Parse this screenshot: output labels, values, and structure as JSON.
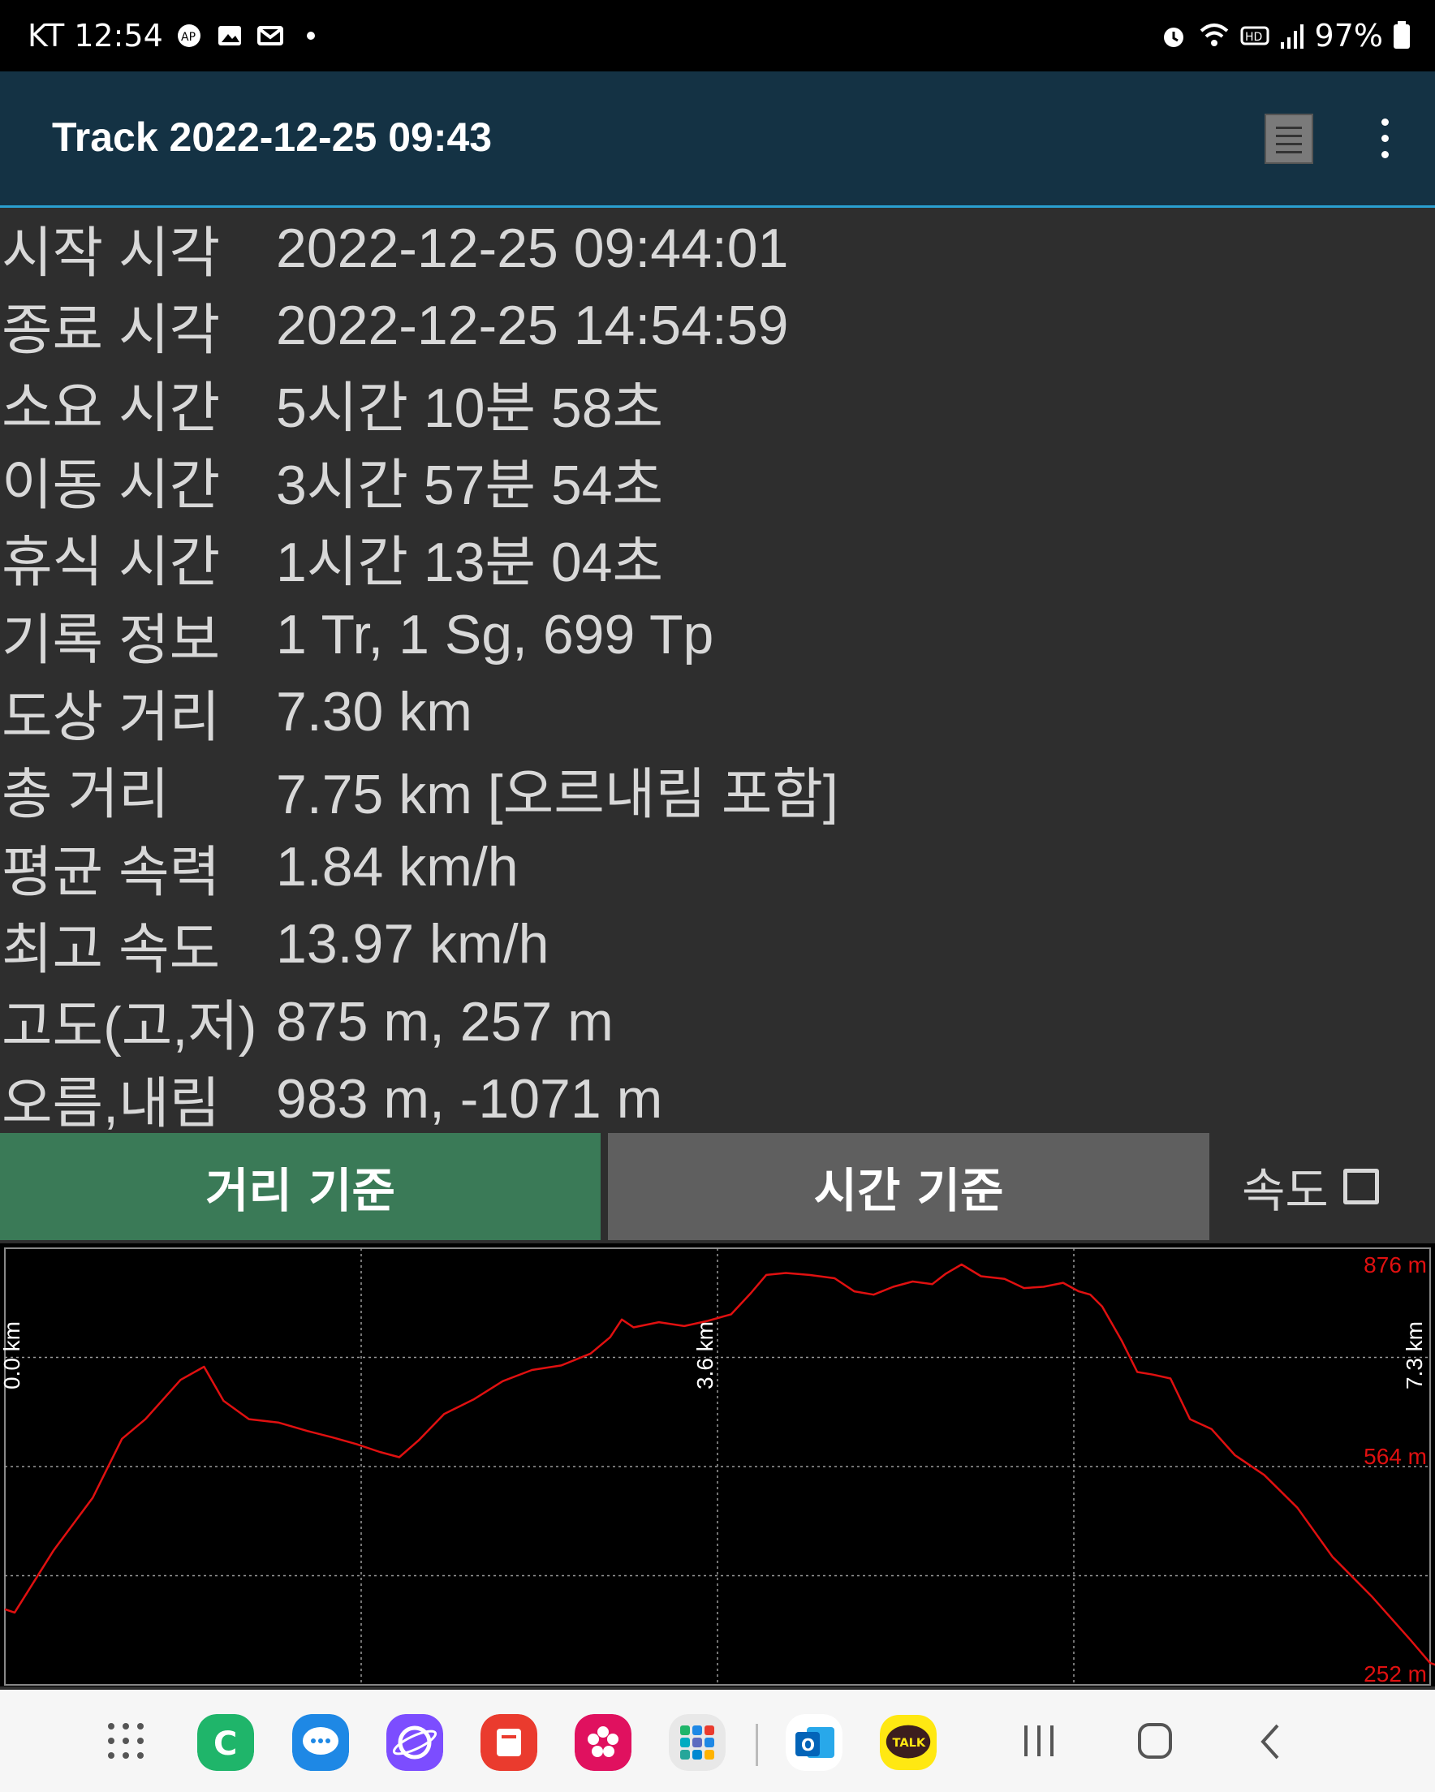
{
  "status_bar": {
    "time_text": "KT 12:54",
    "battery": "97%",
    "icons": [
      "ap-icon",
      "gallery-icon",
      "mail-icon",
      "dot-icon",
      "alarm-icon",
      "wifi-icon",
      "hd-icon",
      "signal-icon",
      "battery-icon"
    ]
  },
  "app_bar": {
    "title": "Track 2022-12-25 09:43",
    "icons": [
      "list-icon",
      "more-vert-icon"
    ]
  },
  "stats": [
    {
      "label": "시작 시각",
      "value": "2022-12-25 09:44:01"
    },
    {
      "label": "종료 시각",
      "value": "2022-12-25 14:54:59"
    },
    {
      "label": "소요 시간",
      "value": "5시간 10분 58초"
    },
    {
      "label": "이동 시간",
      "value": "3시간 57분 54초"
    },
    {
      "label": "휴식 시간",
      "value": "1시간 13분 04초"
    },
    {
      "label": "기록 정보",
      "value": "1 Tr, 1 Sg, 699 Tp"
    },
    {
      "label": "도상 거리",
      "value": "7.30 km"
    },
    {
      "label": "총 거리",
      "value": "7.75 km [오르내림 포함]"
    },
    {
      "label": "평균 속력",
      "value": "1.84 km/h"
    },
    {
      "label": "최고 속도",
      "value": "13.97 km/h"
    },
    {
      "label": "고도(고,저)",
      "value": "875 m, 257 m"
    },
    {
      "label": "오름,내림",
      "value": "983 m, -1071 m"
    }
  ],
  "tabs": {
    "distance_label": "거리 기준",
    "time_label": "시간 기준",
    "speed_label": "속도",
    "speed_checked": false
  },
  "colors": {
    "appbar": "#143244",
    "accent_line": "#2a9fd0",
    "active_tab": "#3a7a57",
    "inactive_tab": "#5f5f5f",
    "line": "#e01010"
  },
  "chart_data": {
    "type": "line",
    "x_tick_labels": [
      "0.0 km",
      "3.6 km",
      "7.3 km"
    ],
    "y_tick_labels": [
      "876 m",
      "564 m",
      "252 m"
    ],
    "xlim": [
      0,
      7.3
    ],
    "ylim": [
      252,
      876
    ],
    "series": [
      {
        "values": [
          [
            0.0,
            350
          ],
          [
            0.05,
            345
          ],
          [
            0.25,
            440
          ],
          [
            0.45,
            520
          ],
          [
            0.6,
            610
          ],
          [
            0.72,
            640
          ],
          [
            0.9,
            700
          ],
          [
            1.02,
            720
          ],
          [
            1.12,
            668
          ],
          [
            1.25,
            640
          ],
          [
            1.4,
            635
          ],
          [
            1.55,
            622
          ],
          [
            1.68,
            612
          ],
          [
            1.8,
            602
          ],
          [
            1.92,
            590
          ],
          [
            2.02,
            582
          ],
          [
            2.12,
            608
          ],
          [
            2.25,
            648
          ],
          [
            2.4,
            670
          ],
          [
            2.55,
            698
          ],
          [
            2.7,
            715
          ],
          [
            2.85,
            722
          ],
          [
            3.0,
            740
          ],
          [
            3.1,
            765
          ],
          [
            3.16,
            792
          ],
          [
            3.22,
            780
          ],
          [
            3.35,
            788
          ],
          [
            3.48,
            782
          ],
          [
            3.6,
            790
          ],
          [
            3.72,
            800
          ],
          [
            3.82,
            832
          ],
          [
            3.9,
            860
          ],
          [
            4.0,
            863
          ],
          [
            4.12,
            860
          ],
          [
            4.25,
            855
          ],
          [
            4.35,
            835
          ],
          [
            4.45,
            830
          ],
          [
            4.55,
            842
          ],
          [
            4.65,
            850
          ],
          [
            4.75,
            846
          ],
          [
            4.82,
            862
          ],
          [
            4.9,
            876
          ],
          [
            5.0,
            858
          ],
          [
            5.12,
            854
          ],
          [
            5.22,
            840
          ],
          [
            5.32,
            842
          ],
          [
            5.42,
            848
          ],
          [
            5.5,
            835
          ],
          [
            5.56,
            830
          ],
          [
            5.62,
            812
          ],
          [
            5.72,
            760
          ],
          [
            5.8,
            712
          ],
          [
            5.88,
            708
          ],
          [
            5.97,
            702
          ],
          [
            6.07,
            640
          ],
          [
            6.18,
            625
          ],
          [
            6.3,
            585
          ],
          [
            6.45,
            555
          ],
          [
            6.62,
            505
          ],
          [
            6.8,
            430
          ],
          [
            7.0,
            370
          ],
          [
            7.2,
            303
          ],
          [
            7.3,
            268
          ],
          [
            7.4,
            258
          ],
          [
            7.5,
            257
          ],
          [
            7.6,
            260
          ]
        ]
      }
    ]
  },
  "nav_bar": {
    "icons": [
      "apps-grid-icon",
      "phone-icon",
      "messages-icon",
      "internet-icon",
      "notes-icon",
      "gallery-flower-icon",
      "folder-icon",
      "outlook-icon",
      "kakaotalk-icon",
      "recents-icon",
      "home-icon",
      "back-icon"
    ],
    "kakao_label": "TALK"
  }
}
